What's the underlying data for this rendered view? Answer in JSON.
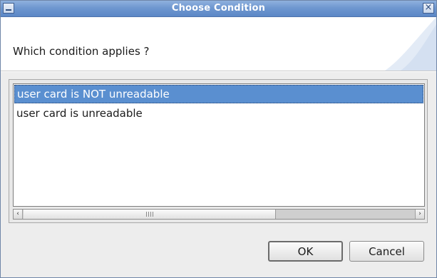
{
  "window": {
    "title": "Choose Condition"
  },
  "header": {
    "question": "Which condition applies ?"
  },
  "list": {
    "items": [
      {
        "label": "user card is NOT unreadable",
        "selected": true
      },
      {
        "label": "user card is unreadable",
        "selected": false
      }
    ]
  },
  "buttons": {
    "ok": "OK",
    "cancel": "Cancel"
  },
  "icons": {
    "window_menu": "minimize-icon",
    "close": "close-icon",
    "scroll_left": "arrow-left-icon",
    "scroll_right": "arrow-right-icon"
  },
  "colors": {
    "titlebar": "#6f97d0",
    "selection": "#5a8fd0",
    "window_bg": "#ededed"
  }
}
